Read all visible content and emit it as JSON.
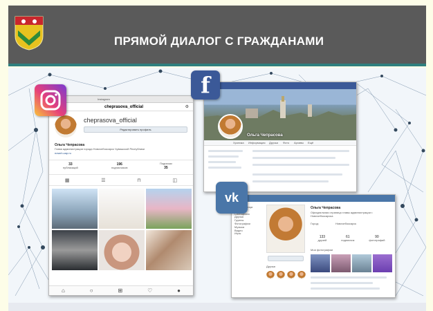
{
  "header": {
    "title": "ПРЯМОЙ ДИАЛОГ С ГРАЖДАНАМИ",
    "colors": {
      "bar": "#5a5a5a",
      "accent": "#2f7f7e"
    },
    "emblem_icon": "coat-of-arms-icon"
  },
  "instagram": {
    "badge_icon": "instagram-icon",
    "window_bar": "Instagram",
    "username": "chеprasova_official",
    "edit_profile": "Редактировать профиль",
    "name": "Ольга Чепрасова",
    "bio": "Глава администрации города Новочебоксарск Чувашской Республики",
    "link": "nowch.cap.ru",
    "stats": [
      {
        "value": "33",
        "label": "публикаций"
      },
      {
        "value": "196",
        "label": "подписчиков"
      },
      {
        "value": "35",
        "label": "Подписки"
      }
    ],
    "nav_icons": [
      "home-icon",
      "search-icon",
      "add-icon",
      "heart-icon",
      "profile-icon"
    ]
  },
  "facebook": {
    "badge_icon": "facebook-icon",
    "name": "Ольга Чепрасова",
    "tabs": [
      "Хроника",
      "Информация",
      "Друзья",
      "Фото",
      "Архивы",
      "Ещё"
    ]
  },
  "vk": {
    "badge_icon": "vk-icon",
    "badge_text": "vk",
    "name": "Ольга Чепрасова",
    "status": "Официальная страница главы администрации г. Новочебоксарска",
    "city_label": "Город:",
    "city": "Новочебоксарск",
    "stats": [
      {
        "value": "133",
        "label": "друзей"
      },
      {
        "value": "61",
        "label": "подписчик"
      },
      {
        "value": "90",
        "label": "фотографий"
      }
    ],
    "menu": [
      "Моя страница",
      "Новости",
      "Сообщения",
      "Друзья",
      "Группы",
      "Фотографии",
      "Музыка",
      "Видео",
      "Игры"
    ],
    "friends_label": "Друзья",
    "photos_label": "Мои фотографии"
  }
}
